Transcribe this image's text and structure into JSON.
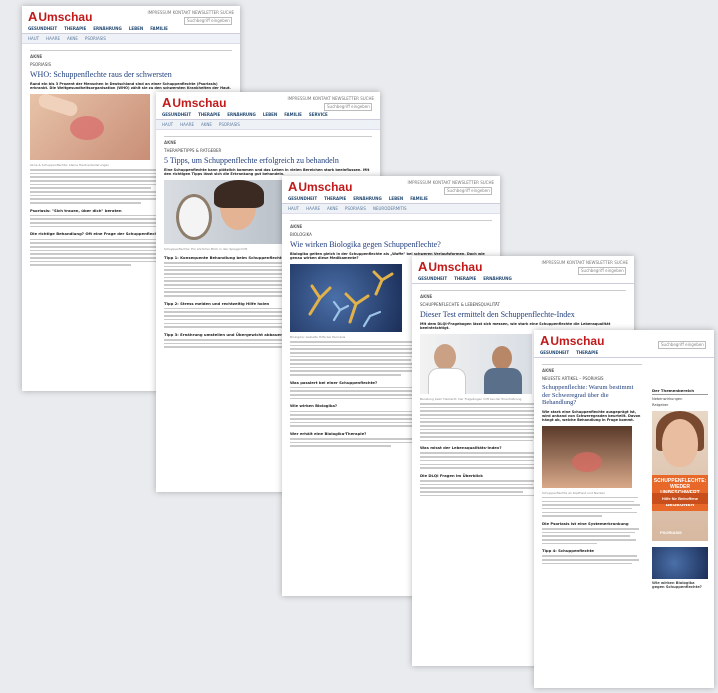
{
  "brand": "Umschau",
  "brand_initial": "A",
  "colors": {
    "brand": "#c21a1a",
    "title": "#1e3d7b",
    "background": "#e9ebee"
  },
  "pages": [
    {
      "crumb": "AKNE",
      "kicker": "PSORIASIS",
      "title": "WHO: Schuppenflechte raus der schwersten",
      "lead": "Rund ein bis 3 Prozent der Menschen in Deutschland sind an einer Schuppenflechte (Psoriasis) erkrankt. Die Weltgesundheitsorganisation (WHO) zählt sie zu den schwersten Krankheiten der Haut.",
      "caption": "Akne & Schuppenflechte: kleine Hautveränderungen",
      "subheading": "Psoriasis: \"Sich trauen, über dich\" beraten",
      "subheading2": "Die richtige Behandlung? Oft eine Frage der Schuppenflechte"
    },
    {
      "crumb": "AKNE",
      "kicker": "THERAPIETIPPS & RATGEBER",
      "title": "5 Tipps, um Schuppenflechte erfolgreich zu behandeln",
      "lead": "Eine Schuppenflechte kann plötzlich kommen und das Leben in vielen Bereichen stark beeinflussen. Mit den richtigen Tipps lässt sich die Erkrankung gut behandeln.",
      "caption": "Schuppenflechte: Ein ehrlicher Blick in den Spiegel hilft",
      "subheading": "Tipp 1: Konsequente Behandlung beim Schuppenflechte-Spezialisten",
      "subheading2": "Tipp 2: Stress meiden und rechtzeitig Hilfe holen",
      "subheading3": "Tipp 3: Ernährung umstellen und Übergewicht abbauen"
    },
    {
      "crumb": "AKNE",
      "kicker": "BIOLOGIKA",
      "title": "Wie wirken Biologika gegen Schuppenflechte?",
      "lead": "Biologika gelten gleich in der Schuppenflechte als „Waffe\" bei schweren Verlaufsformen. Doch wie genau wirken diese Medikamente?",
      "caption": "Biologika: Gezielte Hilfe bei Psoriasis",
      "subheading": "Was passiert bei einer Schuppenflechte?",
      "subheading2": "Wie wirken Biologika?",
      "subheading3": "Wer erhält eine Biologika-Therapie?"
    },
    {
      "crumb": "AKNE",
      "kicker": "SCHUPPENFLECHTE & LEBENSQUALITÄT",
      "title": "Dieser Test ermittelt den Schuppenflechte-Index",
      "lead": "Mit dem DLQI-Fragebogen lässt sich messen, wie stark eine Schuppenflechte die Lebensqualität beeinträchtigt.",
      "caption": "Beratung beim Hautarzt: Der Fragebogen hilft bei der Einschätzung",
      "subheading": "Was misst der Lebensqualitäts-Index?",
      "subheading2": "Die DLQI Fragen im Überblick"
    },
    {
      "crumb": "AKNE",
      "kicker": "NEUESTE ARTIKEL – PSORIASIS",
      "title": "Schuppenflechte: Warum bestimmt der Schweregrad über die Behandlung?",
      "lead": "Wie stark eine Schuppenflechte ausgeprägt ist, wird anhand von Schweregraden beurteilt. Davon hängt ab, welche Behandlung in Frage kommt.",
      "caption": "Schuppenflechte an Kopfhaut und Nacken",
      "subheading": "Die Psoriasis ist eine Systemerkrankung",
      "subheading2": "Tipp 4: Schuppenflechte",
      "sidebar_head": "Der Themenbereich",
      "sidebar_items": [
        "Nebenwirkungen",
        "Ratgeber"
      ],
      "ad_slogan": "SCHUPPENFLECHTE: WIEDER UNBESCHWERT MENSCHEN BEGEGNEN",
      "ad_slogan2": "Hilfe für Betroffene",
      "ad_brand": "PSORIASIS",
      "sidebar_teaser": "Wie wirken Biologika gegen Schuppenflechte?"
    }
  ],
  "toplinks": "IMPRESSUM  KONTAKT  NEWSLETTER  SUCHE",
  "search_placeholder": "Suchbegriff eingeben",
  "nav": [
    "GESUNDHEIT",
    "THERAPIE",
    "ERNÄHRUNG",
    "LEBEN",
    "FAMILIE",
    "SERVICE"
  ],
  "subnav": [
    "HAUT",
    "HAARE",
    "AKNE",
    "PSORIASIS",
    "NEURODERMITIS"
  ]
}
